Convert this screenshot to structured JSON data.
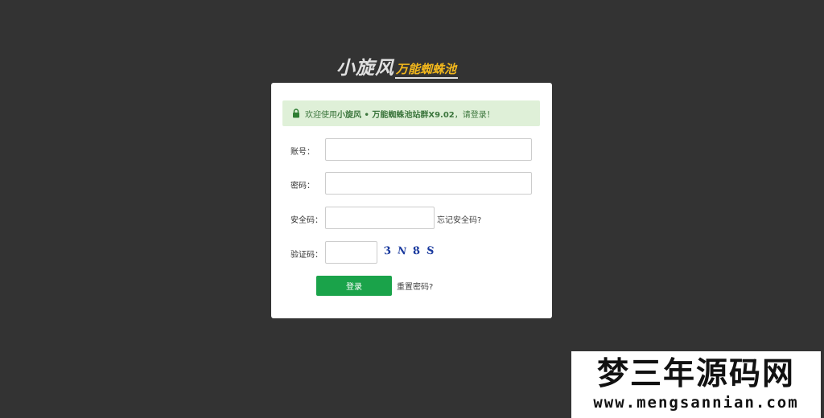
{
  "logo": {
    "main": "小旋风",
    "sub": "万能蜘蛛池"
  },
  "alert": {
    "prefix": "欢迎使用",
    "product": "小旋风 • 万能蜘蛛池站群X9.02",
    "suffix": "，请登录！"
  },
  "form": {
    "account_label": "账号：",
    "account_value": "",
    "password_label": "密码：",
    "password_value": "",
    "security_label": "安全码：",
    "security_value": "",
    "forgot_security_link": "忘记安全码?",
    "captcha_label": "验证码：",
    "captcha_value": "",
    "captcha_chars": [
      "3",
      "N",
      "8",
      "S"
    ],
    "login_button": "登录",
    "reset_password_link": "重置密码?"
  },
  "watermark": {
    "title": "梦三年源码网",
    "url": "www.mengsannian.com"
  },
  "colors": {
    "background": "#333333",
    "alert_bg": "#dff0d8",
    "alert_text": "#3c763d",
    "button": "#1aa34a",
    "captcha": "#1a3a9e",
    "logo_accent": "#f3b81c"
  }
}
